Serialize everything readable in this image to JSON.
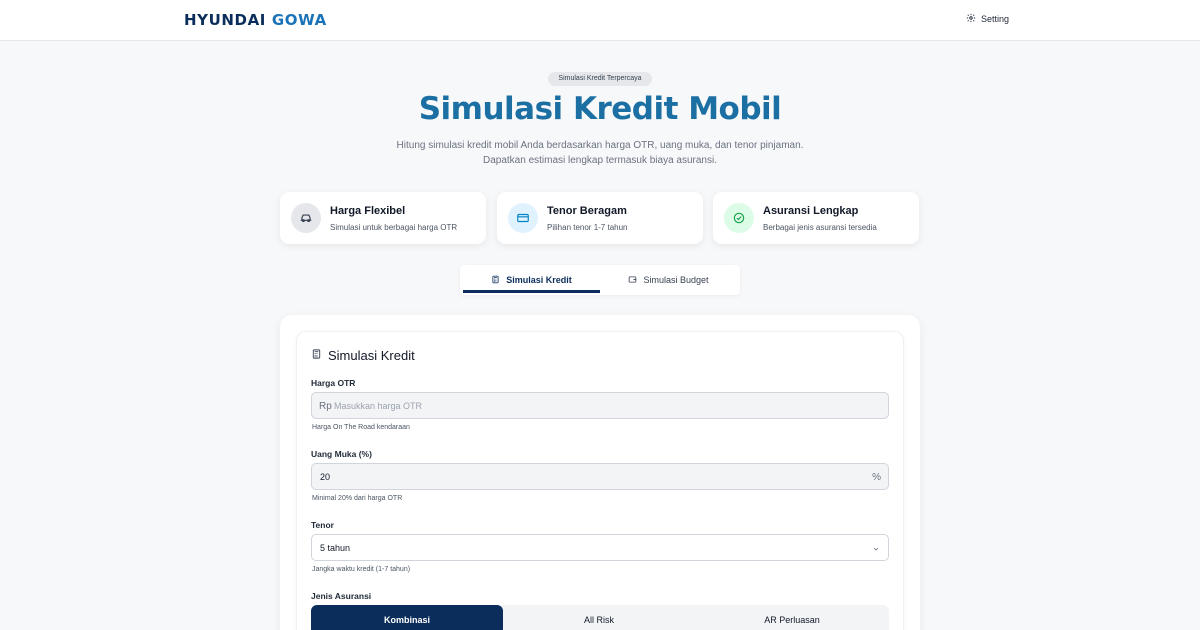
{
  "header": {
    "brand_primary": "HYUNDAI",
    "brand_secondary": "GOWA",
    "setting_label": "Setting"
  },
  "hero": {
    "badge": "Simulasi Kredit Terpercaya",
    "title": "Simulasi Kredit Mobil",
    "description_line1": "Hitung simulasi kredit mobil Anda berdasarkan harga OTR, uang muka, dan tenor pinjaman.",
    "description_line2": "Dapatkan estimasi lengkap termasuk biaya asuransi."
  },
  "features": [
    {
      "icon": "car-icon",
      "title": "Harga Flexibel",
      "description": "Simulasi untuk berbagai harga OTR",
      "icon_bg": "#e5e7eb",
      "icon_color": "#374151"
    },
    {
      "icon": "credit-card-icon",
      "title": "Tenor Beragam",
      "description": "Pilihan tenor 1-7 tahun",
      "icon_bg": "#e0f2fe",
      "icon_color": "#0284c7"
    },
    {
      "icon": "check-circle-icon",
      "title": "Asuransi Lengkap",
      "description": "Berbagai jenis asuransi tersedia",
      "icon_bg": "#dcfce7",
      "icon_color": "#16a34a"
    }
  ],
  "tabs": [
    {
      "label": "Simulasi Kredit",
      "active": true,
      "icon": "calculator-icon"
    },
    {
      "label": "Simulasi Budget",
      "active": false,
      "icon": "wallet-icon"
    }
  ],
  "form": {
    "title": "Simulasi Kredit",
    "harga_otr": {
      "label": "Harga OTR",
      "prefix": "Rp",
      "placeholder": "Masukkan harga OTR",
      "value": "",
      "hint": "Harga On The Road kendaraan"
    },
    "uang_muka": {
      "label": "Uang Muka (%)",
      "value": "20",
      "suffix": "%",
      "hint": "Minimal 20% dari harga OTR"
    },
    "tenor": {
      "label": "Tenor",
      "value": "5 tahun",
      "hint": "Jangka waktu kredit (1-7 tahun)"
    },
    "jenis_asuransi": {
      "label": "Jenis Asuransi",
      "options": [
        "Kombinasi",
        "All Risk",
        "AR Perluasan"
      ],
      "selected": "Kombinasi"
    }
  },
  "colors": {
    "primary": "#0b2d5b",
    "accent": "#1b6fa3",
    "brand_secondary": "#1a73b8"
  }
}
